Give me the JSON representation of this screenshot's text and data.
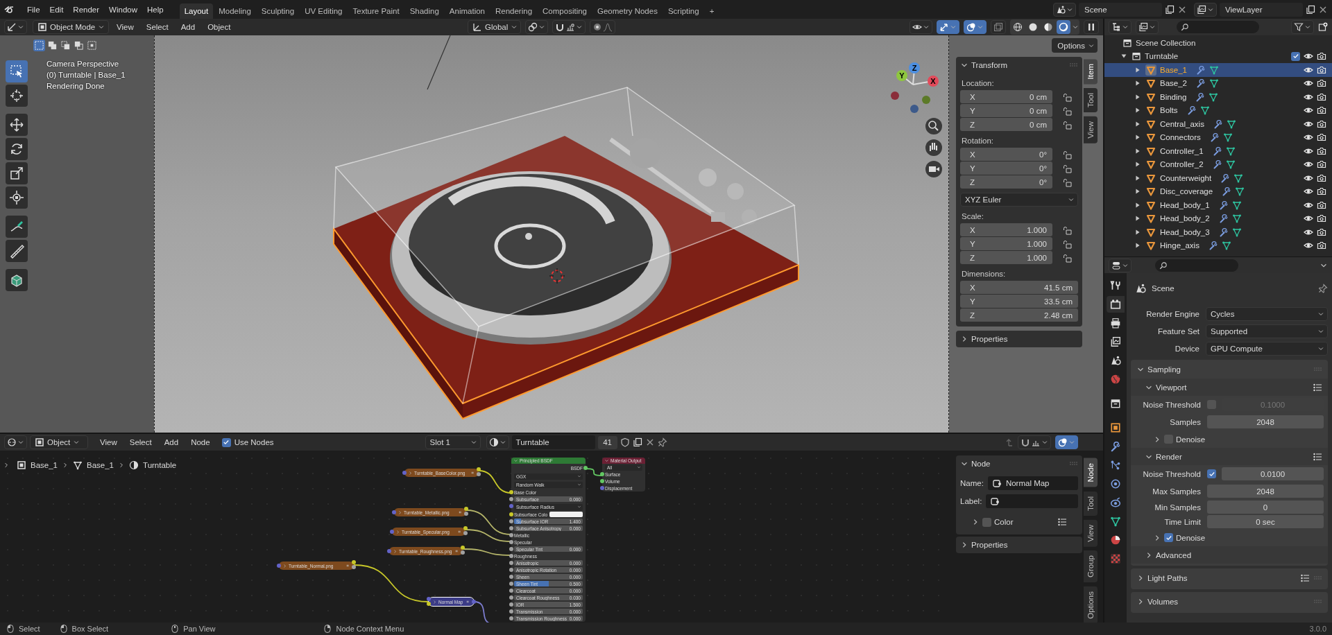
{
  "topbar": {
    "menus": [
      "File",
      "Edit",
      "Render",
      "Window",
      "Help"
    ],
    "workspaces": [
      {
        "label": "Layout",
        "selected": true
      },
      {
        "label": "Modeling",
        "selected": false
      },
      {
        "label": "Sculpting",
        "selected": false
      },
      {
        "label": "UV Editing",
        "selected": false
      },
      {
        "label": "Texture Paint",
        "selected": false
      },
      {
        "label": "Shading",
        "selected": false
      },
      {
        "label": "Animation",
        "selected": false
      },
      {
        "label": "Rendering",
        "selected": false
      },
      {
        "label": "Compositing",
        "selected": false
      },
      {
        "label": "Geometry Nodes",
        "selected": false
      },
      {
        "label": "Scripting",
        "selected": false
      }
    ],
    "add_workspace": "+",
    "scene": "Scene",
    "view_layer": "ViewLayer"
  },
  "viewport": {
    "mode": "Object Mode",
    "menus": [
      "View",
      "Select",
      "Add",
      "Object"
    ],
    "orientation": "Global",
    "toggles": [
      {
        "kind": "visibility",
        "on": false
      },
      {
        "kind": "gizmo",
        "on": true
      },
      {
        "kind": "overlay",
        "on": true
      },
      {
        "kind": "xray",
        "on": false
      }
    ],
    "shading": [
      {
        "kind": "wireframe",
        "selected": false
      },
      {
        "kind": "solid",
        "selected": false
      },
      {
        "kind": "material",
        "selected": false
      },
      {
        "kind": "rendered",
        "selected": true
      }
    ],
    "select_modes": [
      {
        "kind": "set",
        "selected": true
      },
      {
        "kind": "extend",
        "selected": false
      },
      {
        "kind": "subtract",
        "selected": false
      },
      {
        "kind": "difference",
        "selected": false
      },
      {
        "kind": "intersect",
        "selected": false
      }
    ],
    "tools": [
      {
        "kind": "select-box",
        "selected": true
      },
      {
        "kind": "cursor",
        "selected": false
      },
      {
        "kind": "move",
        "selected": false
      },
      {
        "kind": "rotate",
        "selected": false
      },
      {
        "kind": "scale",
        "selected": false
      },
      {
        "kind": "transform",
        "selected": false
      },
      {
        "kind": "annotate",
        "selected": false
      },
      {
        "kind": "measure",
        "selected": false
      },
      {
        "kind": "add-cube",
        "selected": false
      }
    ],
    "info": [
      "Camera Perspective",
      "(0) Turntable | Base_1",
      "Rendering Done"
    ],
    "axes": [
      "X",
      "Y",
      "Z"
    ],
    "options": "Options"
  },
  "sidebar": {
    "tabs": [
      {
        "label": "Item",
        "selected": true
      },
      {
        "label": "Tool",
        "selected": false
      },
      {
        "label": "View",
        "selected": false
      }
    ],
    "title": "Transform",
    "groups": [
      {
        "label": "Location:",
        "lockable": true,
        "fields": [
          {
            "axis": "X",
            "value": "0 cm"
          },
          {
            "axis": "Y",
            "value": "0 cm"
          },
          {
            "axis": "Z",
            "value": "0 cm"
          }
        ]
      },
      {
        "label": "Rotation:",
        "lockable": true,
        "fields": [
          {
            "axis": "X",
            "value": "0°"
          },
          {
            "axis": "Y",
            "value": "0°"
          },
          {
            "axis": "Z",
            "value": "0°"
          }
        ],
        "mode": "XYZ Euler"
      },
      {
        "label": "Scale:",
        "lockable": true,
        "fields": [
          {
            "axis": "X",
            "value": "1.000"
          },
          {
            "axis": "Y",
            "value": "1.000"
          },
          {
            "axis": "Z",
            "value": "1.000"
          }
        ]
      },
      {
        "label": "Dimensions:",
        "lockable": false,
        "fields": [
          {
            "axis": "X",
            "value": "41.5 cm"
          },
          {
            "axis": "Y",
            "value": "33.5 cm"
          },
          {
            "axis": "Z",
            "value": "2.48 cm"
          }
        ]
      }
    ],
    "collapsed_panel": "Properties"
  },
  "outliner": {
    "root": "Scene Collection",
    "collections": [
      {
        "name": "Turntable",
        "checked": true,
        "expanded": true,
        "children": [
          {
            "name": "Base_1",
            "selected": true
          },
          {
            "name": "Base_2",
            "selected": false
          },
          {
            "name": "Binding",
            "selected": false
          },
          {
            "name": "Bolts",
            "selected": false
          },
          {
            "name": "Central_axis",
            "selected": false
          },
          {
            "name": "Connectors",
            "selected": false
          },
          {
            "name": "Controller_1",
            "selected": false
          },
          {
            "name": "Controller_2",
            "selected": false
          },
          {
            "name": "Counterweight",
            "selected": false
          },
          {
            "name": "Disc_coverage",
            "selected": false
          },
          {
            "name": "Head_body_1",
            "selected": false
          },
          {
            "name": "Head_body_2",
            "selected": false
          },
          {
            "name": "Head_body_3",
            "selected": false
          },
          {
            "name": "Hinge_axis",
            "selected": false
          }
        ]
      }
    ]
  },
  "properties": {
    "tabs": [
      {
        "kind": "tool",
        "selected": false
      },
      {
        "kind": "render",
        "selected": true
      },
      {
        "kind": "output",
        "selected": false
      },
      {
        "kind": "view-layer",
        "selected": false
      },
      {
        "kind": "scene",
        "selected": false
      },
      {
        "kind": "world",
        "selected": false
      },
      {
        "kind": "collection",
        "selected": false
      },
      {
        "kind": "object",
        "selected": false
      },
      {
        "kind": "modifiers",
        "selected": false
      },
      {
        "kind": "particles",
        "selected": false
      },
      {
        "kind": "physics",
        "selected": false
      },
      {
        "kind": "constraints",
        "selected": false
      },
      {
        "kind": "data",
        "selected": false
      },
      {
        "kind": "material",
        "selected": false
      },
      {
        "kind": "texture",
        "selected": false
      }
    ],
    "context": "Scene",
    "items": [
      {
        "kind": "dropdown",
        "label": "Render Engine",
        "value": "Cycles"
      },
      {
        "kind": "dropdown",
        "label": "Feature Set",
        "value": "Supported"
      },
      {
        "kind": "dropdown",
        "label": "Device",
        "value": "GPU Compute"
      },
      {
        "kind": "panel",
        "label": "Sampling",
        "expanded": true,
        "presets": false,
        "children": [
          {
            "kind": "subpanel",
            "label": "Viewport",
            "expanded": true,
            "presets": true,
            "children": [
              {
                "kind": "check-number",
                "label": "Noise Threshold",
                "checked": false,
                "value": "0.1000"
              },
              {
                "kind": "number",
                "label": "Samples",
                "value": "2048"
              },
              {
                "kind": "subpanel",
                "label": "Denoise",
                "expanded": false,
                "checked": false
              }
            ]
          },
          {
            "kind": "subpanel",
            "label": "Render",
            "expanded": true,
            "presets": true,
            "children": [
              {
                "kind": "check-number",
                "label": "Noise Threshold",
                "checked": true,
                "value": "0.0100"
              },
              {
                "kind": "number",
                "label": "Max Samples",
                "value": "2048"
              },
              {
                "kind": "number",
                "label": "Min Samples",
                "value": "0"
              },
              {
                "kind": "number",
                "label": "Time Limit",
                "value": "0 sec"
              },
              {
                "kind": "subpanel",
                "label": "Denoise",
                "expanded": false,
                "checked": true
              }
            ]
          },
          {
            "kind": "subpanel",
            "label": "Advanced",
            "expanded": false
          }
        ]
      },
      {
        "kind": "panel",
        "label": "Light Paths",
        "expanded": false,
        "presets": true
      },
      {
        "kind": "panel",
        "label": "Volumes",
        "expanded": false,
        "presets": false
      }
    ]
  },
  "node_editor": {
    "type": "Object",
    "menus": [
      "View",
      "Select",
      "Add",
      "Node"
    ],
    "use_nodes": {
      "label": "Use Nodes",
      "checked": true
    },
    "slot": "Slot 1",
    "material": "Turntable",
    "users": "41",
    "overlay": {
      "on": true
    },
    "breadcrumb": [
      {
        "kind": "object",
        "label": "Base_1"
      },
      {
        "kind": "mesh",
        "label": "Base_1"
      },
      {
        "kind": "material",
        "label": "Turntable"
      }
    ],
    "nodes": [
      {
        "kind": "texture",
        "label": "Turntable_BaseColor.png",
        "selected": false
      },
      {
        "kind": "texture",
        "label": "Turntable_Metallic.png",
        "selected": false
      },
      {
        "kind": "texture",
        "label": "Turntable_Specular.png",
        "selected": false
      },
      {
        "kind": "texture",
        "label": "Turntable_Roughness.png",
        "selected": false
      },
      {
        "kind": "texture",
        "label": "Turntable_Normal.png",
        "selected": false
      },
      {
        "kind": "vector",
        "label": "Normal Map",
        "selected": true
      },
      {
        "kind": "shader",
        "label": "Principled BSDF",
        "selected": false,
        "rows": [
          {
            "kind": "output",
            "label": "BSDF",
            "color": "#63c763"
          },
          {
            "kind": "dropdown",
            "label": "GGX"
          },
          {
            "kind": "dropdown",
            "label": "Random Walk"
          },
          {
            "kind": "input",
            "label": "Base Color",
            "color": "#c7c729"
          },
          {
            "kind": "value",
            "label": "Subsurface",
            "value": "0.000",
            "color": "#a1a1a1"
          },
          {
            "kind": "dropdown",
            "label": "Subsurface Radius",
            "color": "#6363c7"
          },
          {
            "kind": "swatch",
            "label": "Subsurface Colo",
            "color": "#c7c729"
          },
          {
            "kind": "slider",
            "label": "Subsurface IOR",
            "value": "1.400",
            "level": 0.1,
            "color": "#a1a1a1"
          },
          {
            "kind": "value",
            "label": "Subsurface Anisotropy",
            "value": "0.000",
            "color": "#a1a1a1"
          },
          {
            "kind": "input",
            "label": "Metallic",
            "color": "#a1a1a1"
          },
          {
            "kind": "input",
            "label": "Specular",
            "color": "#a1a1a1"
          },
          {
            "kind": "value",
            "label": "Specular Tint",
            "value": "0.000",
            "color": "#a1a1a1"
          },
          {
            "kind": "input",
            "label": "Roughness",
            "color": "#a1a1a1"
          },
          {
            "kind": "value",
            "label": "Anisotropic",
            "value": "0.000",
            "color": "#a1a1a1"
          },
          {
            "kind": "value",
            "label": "Anisotropic Rotation",
            "value": "0.000",
            "color": "#a1a1a1"
          },
          {
            "kind": "value",
            "label": "Sheen",
            "value": "0.000",
            "color": "#a1a1a1"
          },
          {
            "kind": "slider",
            "label": "Sheen Tint",
            "value": "0.500",
            "level": 0.5,
            "color": "#a1a1a1"
          },
          {
            "kind": "value",
            "label": "Clearcoat",
            "value": "0.000",
            "color": "#a1a1a1"
          },
          {
            "kind": "value",
            "label": "Clearcoat Roughness",
            "value": "0.030",
            "color": "#a1a1a1"
          },
          {
            "kind": "value",
            "label": "IOR",
            "value": "1.500",
            "color": "#a1a1a1"
          },
          {
            "kind": "value",
            "label": "Transmission",
            "value": "0.000",
            "color": "#a1a1a1"
          },
          {
            "kind": "value",
            "label": "Transmission Roughness",
            "value": "0.000",
            "color": "#a1a1a1"
          }
        ]
      },
      {
        "kind": "output",
        "label": "Material Output",
        "selected": false,
        "rows": [
          {
            "kind": "dropdown",
            "label": "All"
          },
          {
            "kind": "input",
            "label": "Surface",
            "color": "#63c763"
          },
          {
            "kind": "input",
            "label": "Volume",
            "color": "#63c763"
          },
          {
            "kind": "input",
            "label": "Displacement",
            "color": "#6363c7"
          }
        ]
      }
    ],
    "sidebar": {
      "tabs": [
        {
          "label": "Node",
          "selected": true
        },
        {
          "label": "Tool",
          "selected": false
        },
        {
          "label": "View",
          "selected": false
        },
        {
          "label": "Group",
          "selected": false
        },
        {
          "label": "Options",
          "selected": false
        }
      ],
      "title": "Node",
      "name_label": "Name:",
      "name": "Normal Map",
      "label_label": "Label:",
      "color": {
        "label": "Color",
        "checked": false
      },
      "collapsed_panel": "Properties"
    }
  },
  "statusbar": {
    "hints": [
      {
        "kind": "left",
        "label": "Select"
      },
      {
        "kind": "left",
        "label": "Box Select"
      },
      {
        "kind": "middle",
        "label": "Pan View"
      },
      {
        "kind": "right",
        "label": "Node Context Menu"
      }
    ],
    "version": "3.0.0"
  }
}
